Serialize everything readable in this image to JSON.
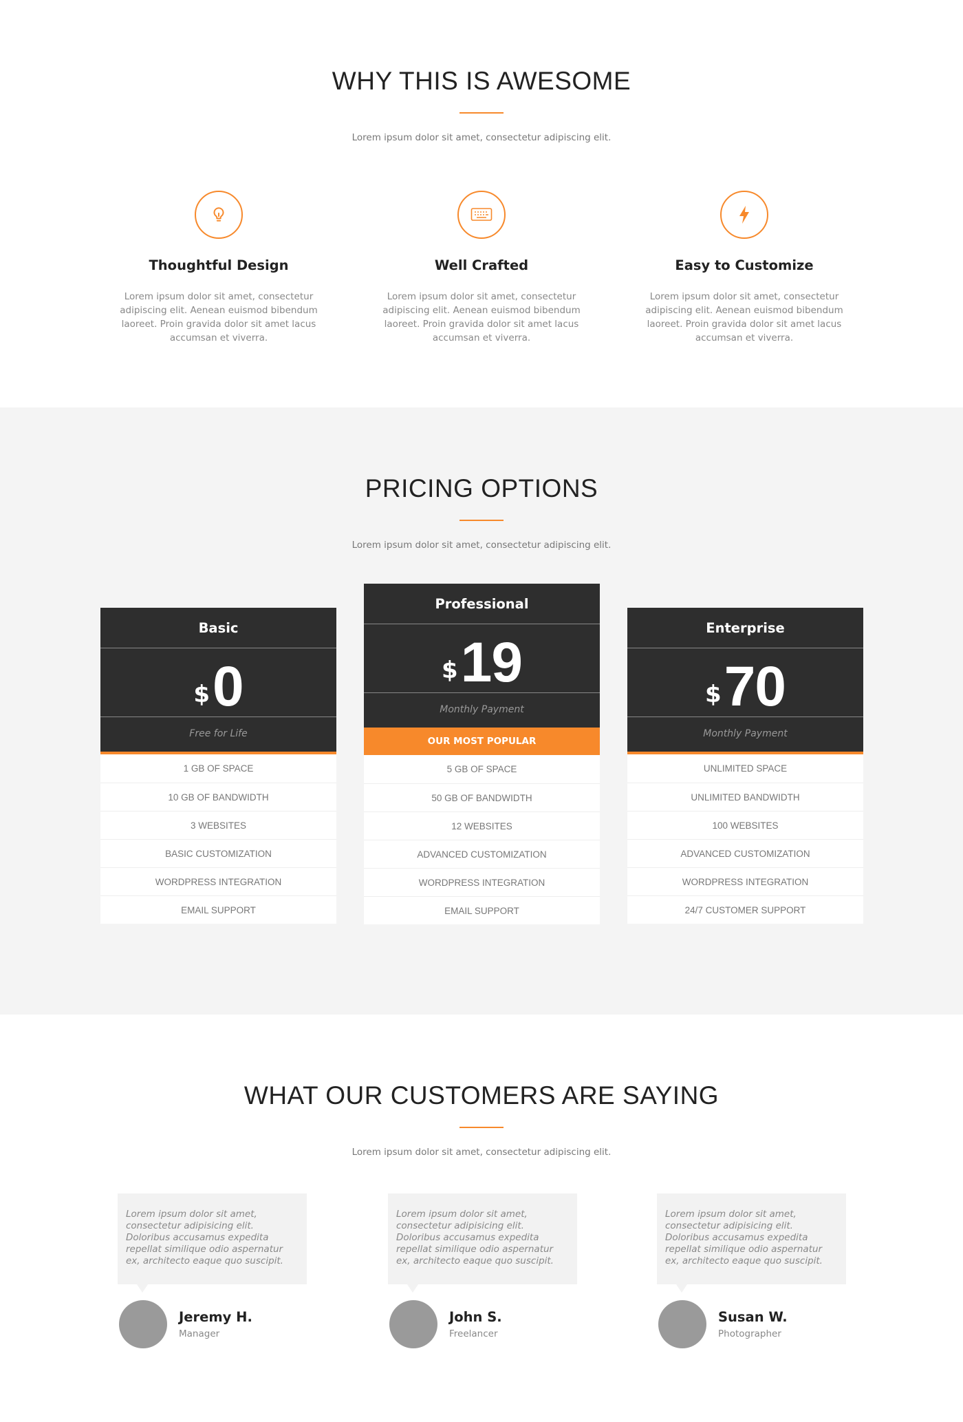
{
  "colors": {
    "accent": "#f7892b",
    "dark": "#2e2e2e",
    "section_bg": "#f4f4f4"
  },
  "features_section": {
    "title": "WHY THIS IS AWESOME",
    "subtitle": "Lorem ipsum dolor sit amet, consectetur adipiscing elit.",
    "items": [
      {
        "icon": "lightbulb-icon",
        "title": "Thoughtful Design",
        "text": "Lorem ipsum dolor sit amet, consectetur adipiscing elit. Aenean euismod bibendum laoreet. Proin gravida dolor sit amet lacus accumsan et viverra."
      },
      {
        "icon": "keyboard-icon",
        "title": "Well Crafted",
        "text": "Lorem ipsum dolor sit amet, consectetur adipiscing elit. Aenean euismod bibendum laoreet. Proin gravida dolor sit amet lacus accumsan et viverra."
      },
      {
        "icon": "lightning-icon",
        "title": "Easy to Customize",
        "text": "Lorem ipsum dolor sit amet, consectetur adipiscing elit. Aenean euismod bibendum laoreet. Proin gravida dolor sit amet lacus accumsan et viverra."
      }
    ]
  },
  "pricing_section": {
    "title": "PRICING OPTIONS",
    "subtitle": "Lorem ipsum dolor sit amet, consectetur adipiscing elit.",
    "plans": [
      {
        "name": "Basic",
        "currency": "$",
        "price": "0",
        "period": "Free for Life",
        "features": [
          "1 GB OF SPACE",
          "10 GB OF BANDWIDTH",
          "3 WEBSITES",
          "BASIC CUSTOMIZATION",
          "WORDPRESS INTEGRATION",
          "EMAIL SUPPORT"
        ]
      },
      {
        "name": "Professional",
        "currency": "$",
        "price": "19",
        "period": "Monthly Payment",
        "badge": "OUR MOST POPULAR",
        "features": [
          "5 GB OF SPACE",
          "50 GB OF BANDWIDTH",
          "12 WEBSITES",
          "ADVANCED CUSTOMIZATION",
          "WORDPRESS INTEGRATION",
          "EMAIL SUPPORT"
        ]
      },
      {
        "name": "Enterprise",
        "currency": "$",
        "price": "70",
        "period": "Monthly Payment",
        "features": [
          "UNLIMITED SPACE",
          "UNLIMITED BANDWIDTH",
          "100 WEBSITES",
          "ADVANCED CUSTOMIZATION",
          "WORDPRESS INTEGRATION",
          "24/7 CUSTOMER SUPPORT"
        ]
      }
    ]
  },
  "testimonials_section": {
    "title": "WHAT OUR CUSTOMERS ARE SAYING",
    "subtitle": "Lorem ipsum dolor sit amet, consectetur adipiscing elit.",
    "items": [
      {
        "quote": "Lorem ipsum dolor sit amet, consectetur adipisicing elit. Doloribus accusamus expedita repellat similique odio aspernatur ex, architecto eaque quo suscipit.",
        "name": "Jeremy H.",
        "role": "Manager"
      },
      {
        "quote": "Lorem ipsum dolor sit amet, consectetur adipisicing elit. Doloribus accusamus expedita repellat similique odio aspernatur ex, architecto eaque quo suscipit.",
        "name": "John S.",
        "role": "Freelancer"
      },
      {
        "quote": "Lorem ipsum dolor sit amet, consectetur adipisicing elit. Doloribus accusamus expedita repellat similique odio aspernatur ex, architecto eaque quo suscipit.",
        "name": "Susan W.",
        "role": "Photographer"
      }
    ]
  }
}
